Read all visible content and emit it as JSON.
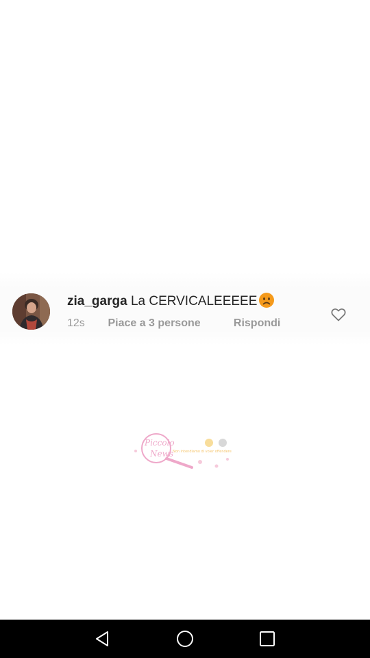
{
  "comment": {
    "username": "zia_garga",
    "text": "La CERVICALEEEEE",
    "emoji_icon": "frowning-face-emoji",
    "time": "12s",
    "likes": "Piace a 3 persone",
    "reply": "Rispondi",
    "like_icon": "heart-outline-icon"
  },
  "watermark": {
    "logo_text_line1": "Piccolo",
    "logo_text_line2": "News",
    "tagline": "Non intendiamo di voler offendere"
  },
  "navbar": {
    "back_icon": "back-triangle-icon",
    "home_icon": "home-circle-icon",
    "recent_icon": "recent-apps-square-icon"
  },
  "colors": {
    "text_primary": "#262626",
    "text_secondary": "#999999",
    "navbar_bg": "#000000",
    "emoji_fill": "#f59a1b",
    "watermark_pink": "#e98bb7"
  }
}
